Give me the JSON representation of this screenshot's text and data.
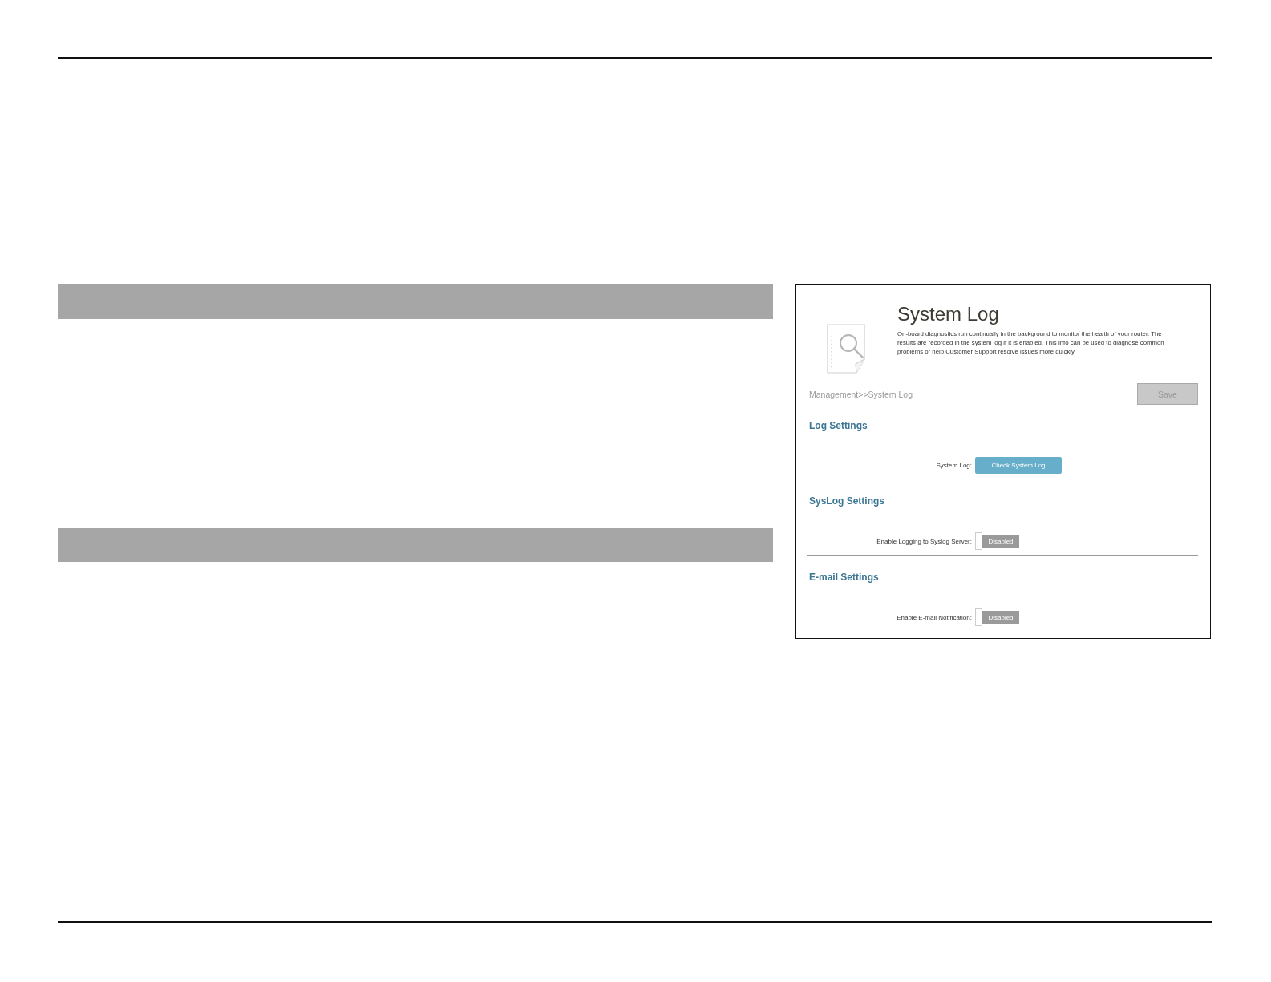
{
  "screenshot": {
    "title": "System Log",
    "description": "On-board diagnostics run continually in the background to monitor the health of your router. The results are recorded in the system log if it is enabled. This info can be used to diagnose common problems or help Customer Support resolve issues more quickly.",
    "breadcrumb": "Management>>System Log",
    "save_button": {
      "label": "Save",
      "disabled": true
    },
    "sections": [
      {
        "heading": "Log Settings",
        "rows": [
          {
            "kind": "button",
            "label": "System Log:",
            "button": "Check System Log"
          }
        ]
      },
      {
        "heading": "SysLog Settings",
        "rows": [
          {
            "kind": "toggle",
            "label": "Enable Logging to Syslog Server:",
            "state_label": "Disabled",
            "on": false
          }
        ]
      },
      {
        "heading": "E-mail Settings",
        "rows": [
          {
            "kind": "toggle",
            "label": "Enable E-mail Notification:",
            "state_label": "Disabled",
            "on": false
          }
        ]
      }
    ]
  }
}
